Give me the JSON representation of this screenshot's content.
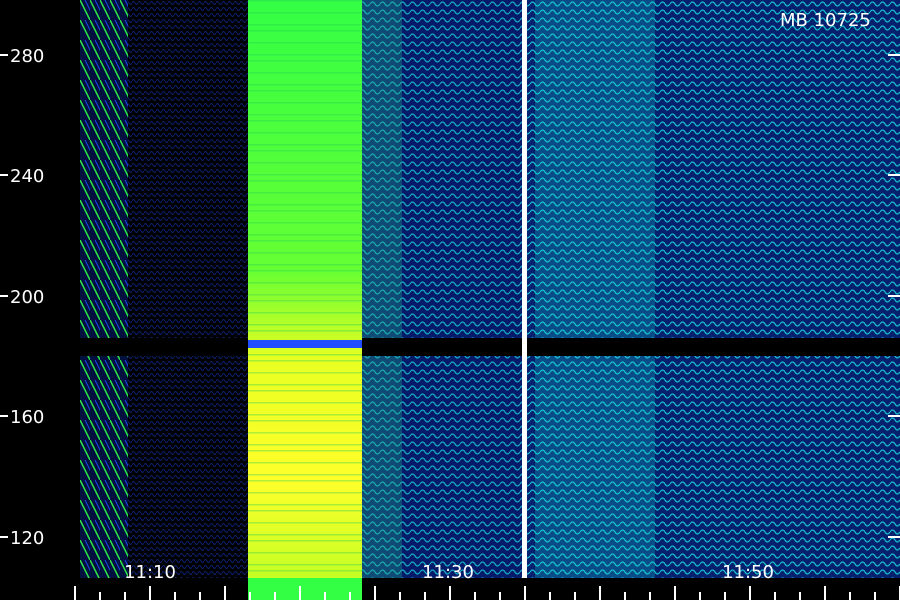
{
  "stamp": "MB 10725",
  "y_ticks": [
    "280",
    "240",
    "200",
    "160",
    "120"
  ],
  "x_ticks": [
    "11:10",
    "11:30",
    "11:50"
  ],
  "palette": {
    "background": "#000000",
    "dark_blue": "#0a1a8c",
    "blue": "#1f4dff",
    "cyan": "#18d2d8",
    "green": "#33ff44",
    "yellow_green": "#b8ff22",
    "yellow": "#ffff2a",
    "white": "#ffffff"
  }
}
